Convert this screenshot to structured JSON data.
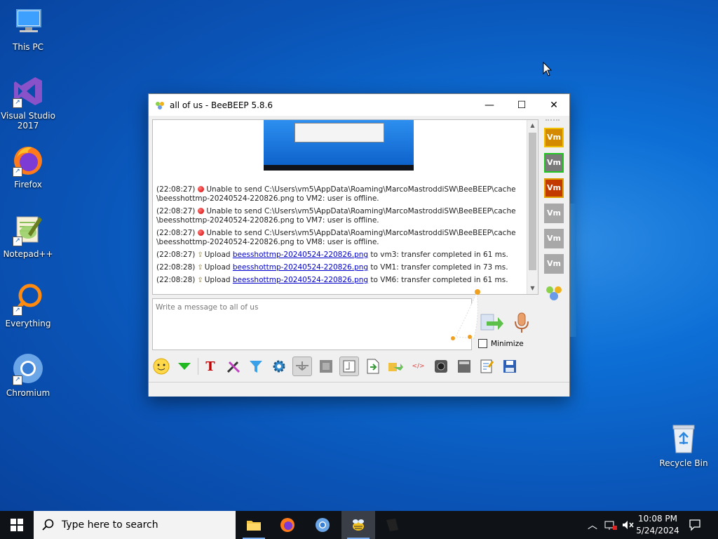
{
  "desktop": {
    "icons": [
      {
        "label": "This PC",
        "icon": "computer-icon"
      },
      {
        "label": "Visual Studio 2017",
        "icon": "visual-studio-icon"
      },
      {
        "label": "Firefox",
        "icon": "firefox-icon"
      },
      {
        "label": "Notepad++",
        "icon": "notepadpp-icon"
      },
      {
        "label": "Everything",
        "icon": "search-magnifier-icon"
      },
      {
        "label": "Chromium",
        "icon": "chromium-icon"
      },
      {
        "label": "Recycle Bin",
        "icon": "recycle-bin-icon"
      }
    ]
  },
  "window": {
    "title": "all of us - BeeBEEP 5.8.6",
    "controls": {
      "minimize": "—",
      "maximize": "☐",
      "close": "✕"
    },
    "messages": [
      {
        "time": "(22:08:27)",
        "type": "error",
        "line1": "Unable to send C:\\Users\\vm5\\AppData\\Roaming\\MarcoMastroddiSW\\BeeBEEP\\cache",
        "line2": "\\beesshottmp-20240524-220826.png to VM2: user is offline."
      },
      {
        "time": "(22:08:27)",
        "type": "error",
        "line1": "Unable to send C:\\Users\\vm5\\AppData\\Roaming\\MarcoMastroddiSW\\BeeBEEP\\cache",
        "line2": "\\beesshottmp-20240524-220826.png to VM7: user is offline."
      },
      {
        "time": "(22:08:27)",
        "type": "error",
        "line1": "Unable to send C:\\Users\\vm5\\AppData\\Roaming\\MarcoMastroddiSW\\BeeBEEP\\cache",
        "line2": "\\beesshottmp-20240524-220826.png to VM8: user is offline."
      },
      {
        "time": "(22:08:27)",
        "type": "upload",
        "prefix": "Upload",
        "file": "beesshottmp-20240524-220826.png",
        "suffix": "to vm3: transfer completed in 61 ms."
      },
      {
        "time": "(22:08:28)",
        "type": "upload",
        "prefix": "Upload",
        "file": "beesshottmp-20240524-220826.png",
        "suffix": "to VM1: transfer completed in 73 ms."
      },
      {
        "time": "(22:08:28)",
        "type": "upload",
        "prefix": "Upload",
        "file": "beesshottmp-20240524-220826.png",
        "suffix": "to VM6: transfer completed in 61 ms."
      }
    ],
    "input_placeholder": "Write a message to all of us",
    "minimize_label": "Minimize",
    "users": [
      {
        "label": "Vm",
        "color": "#d48a00",
        "border": "#f0c000"
      },
      {
        "label": "Vm",
        "color": "#7a7a7a",
        "border": "#22c522"
      },
      {
        "label": "Vm",
        "color": "#c23a00",
        "border": "#e0a000"
      },
      {
        "label": "Vm",
        "color": "#a8a8a8",
        "border": "#a8a8a8"
      },
      {
        "label": "Vm",
        "color": "#a8a8a8",
        "border": "#a8a8a8"
      },
      {
        "label": "Vm",
        "color": "#a8a8a8",
        "border": "#a8a8a8"
      }
    ],
    "toolbar": [
      "emoticons-icon",
      "download-icon",
      "font-icon",
      "color-picker-icon",
      "filter-icon",
      "settings-icon",
      "screenshot-icon",
      "video-icon",
      "compact-view-icon",
      "save-icon",
      "send-file-icon",
      "html-icon",
      "webcam-icon",
      "calculator-icon",
      "notes-icon",
      "floppy-save-icon"
    ]
  },
  "taskbar": {
    "search_placeholder": "Type here to search",
    "time": "10:08 PM",
    "date": "5/24/2024"
  }
}
